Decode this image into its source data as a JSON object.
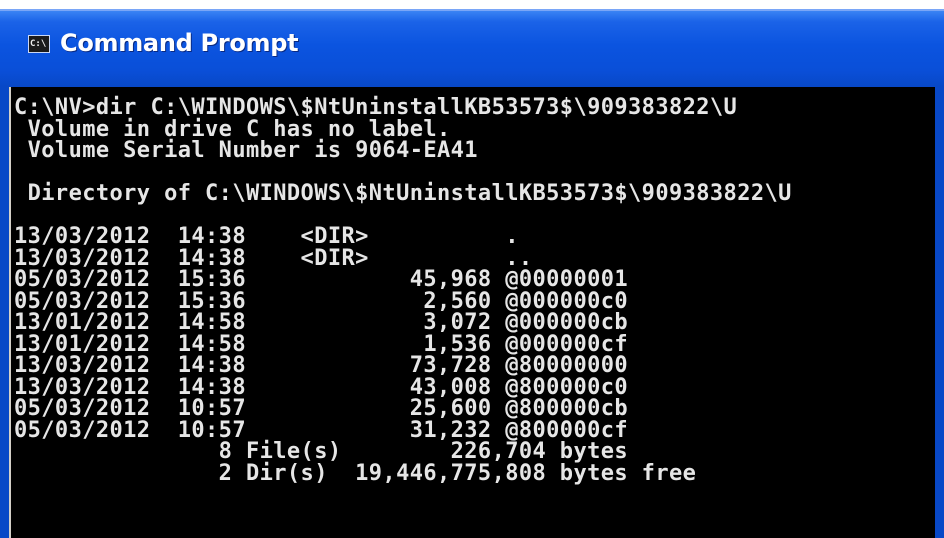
{
  "window": {
    "title": "Command Prompt",
    "icon": "console-icon",
    "icon_text": "C:\\"
  },
  "console": {
    "command_line": "C:\\NV>dir C:\\WINDOWS\\$NtUninstallKB53573$\\909383822\\U",
    "volume_label": " Volume in drive C has no label.",
    "volume_serial": " Volume Serial Number is 9064-EA41",
    "directory_line": " Directory of C:\\WINDOWS\\$NtUninstallKB53573$\\909383822\\U",
    "entries": [
      "13/03/2012  14:38    <DIR>          .",
      "13/03/2012  14:38    <DIR>          ..",
      "05/03/2012  15:36            45,968 @00000001",
      "05/03/2012  15:36             2,560 @000000c0",
      "13/01/2012  14:58             3,072 @000000cb",
      "13/01/2012  14:58             1,536 @000000cf",
      "13/03/2012  14:38            73,728 @80000000",
      "13/03/2012  14:38            43,008 @800000c0",
      "05/03/2012  10:57            25,600 @800000cb",
      "05/03/2012  10:57            31,232 @800000cf"
    ],
    "summary_files": "               8 File(s)        226,704 bytes",
    "summary_dirs": "               2 Dir(s)  19,446,775,808 bytes free"
  },
  "colors": {
    "title_bar": "#0b54e0",
    "console_background": "#000000",
    "console_text": "#e6e6e6"
  }
}
